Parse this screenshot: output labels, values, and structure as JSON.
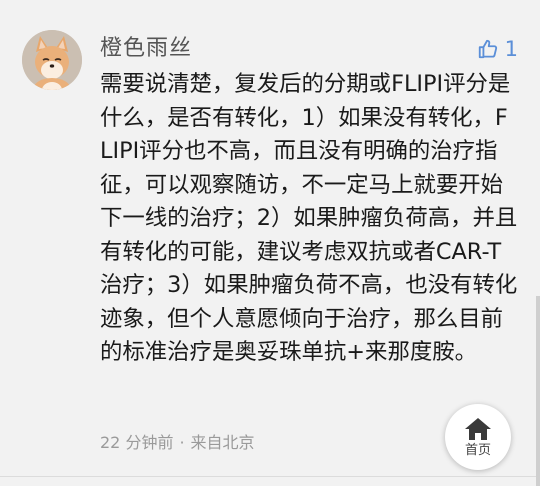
{
  "comment": {
    "username": "橙色雨丝",
    "like_count": "1",
    "text": "需要说清楚，复发后的分期或FLIPI评分是什么，是否有转化，1）如果没有转化，FLIPI评分也不高，而且没有明确的治疗指征，可以观察随访，不一定马上就要开始下一线的治疗；2）如果肿瘤负荷高，并且有转化的可能，建议考虑双抗或者CAR-T治疗；3）如果肿瘤负荷不高，也没有转化迹象，但个人意愿倾向于治疗，那么目前的标准治疗是奥妥珠单抗+来那度胺。",
    "time": "22 分钟前",
    "separator": "·",
    "location": "来自北京"
  },
  "home_button": {
    "label": "首页",
    "icon": "home-icon"
  },
  "avatar": {
    "icon": "avatar-shiba-icon"
  },
  "like": {
    "icon": "thumbs-up-icon"
  },
  "colors": {
    "background": "#f2f2f2",
    "text": "#1a1a1a",
    "username": "#555555",
    "like_accent": "#5b8fd8",
    "meta": "#9a9a9a"
  }
}
